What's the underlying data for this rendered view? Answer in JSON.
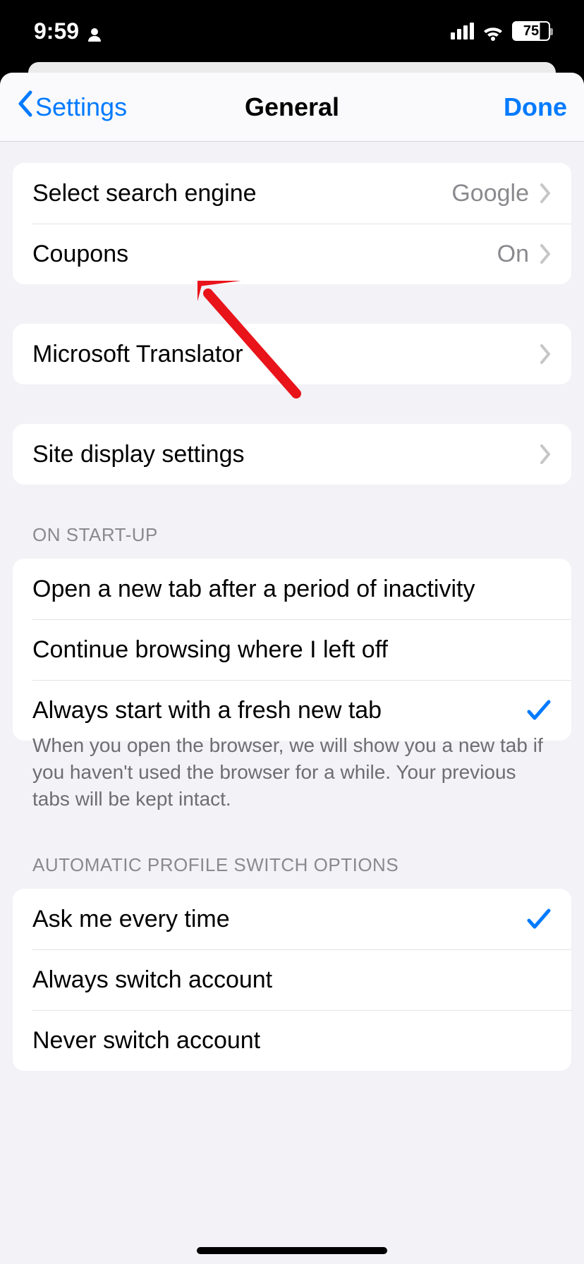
{
  "status_bar": {
    "time": "9:59",
    "battery_percent": "75"
  },
  "nav": {
    "back_label": "Settings",
    "title": "General",
    "done_label": "Done"
  },
  "groups": {
    "g1": {
      "rows": {
        "search": {
          "label": "Select search engine",
          "value": "Google"
        },
        "coupons": {
          "label": "Coupons",
          "value": "On"
        }
      }
    },
    "g2": {
      "rows": {
        "translator": {
          "label": "Microsoft Translator"
        }
      }
    },
    "g3": {
      "rows": {
        "site_display": {
          "label": "Site display settings"
        }
      }
    }
  },
  "startup": {
    "header": "ON START-UP",
    "rows": {
      "inactivity": {
        "label": "Open a new tab after a period of inactivity"
      },
      "continue": {
        "label": "Continue browsing where I left off"
      },
      "fresh": {
        "label": "Always start with a fresh new tab"
      }
    },
    "footer": "When you open the browser, we will show you a new tab if you haven't used the browser for a while. Your previous tabs will be kept intact."
  },
  "profile_switch": {
    "header": "AUTOMATIC PROFILE SWITCH OPTIONS",
    "rows": {
      "ask": {
        "label": "Ask me every time"
      },
      "always": {
        "label": "Always switch account"
      },
      "never": {
        "label": "Never switch account"
      }
    }
  }
}
